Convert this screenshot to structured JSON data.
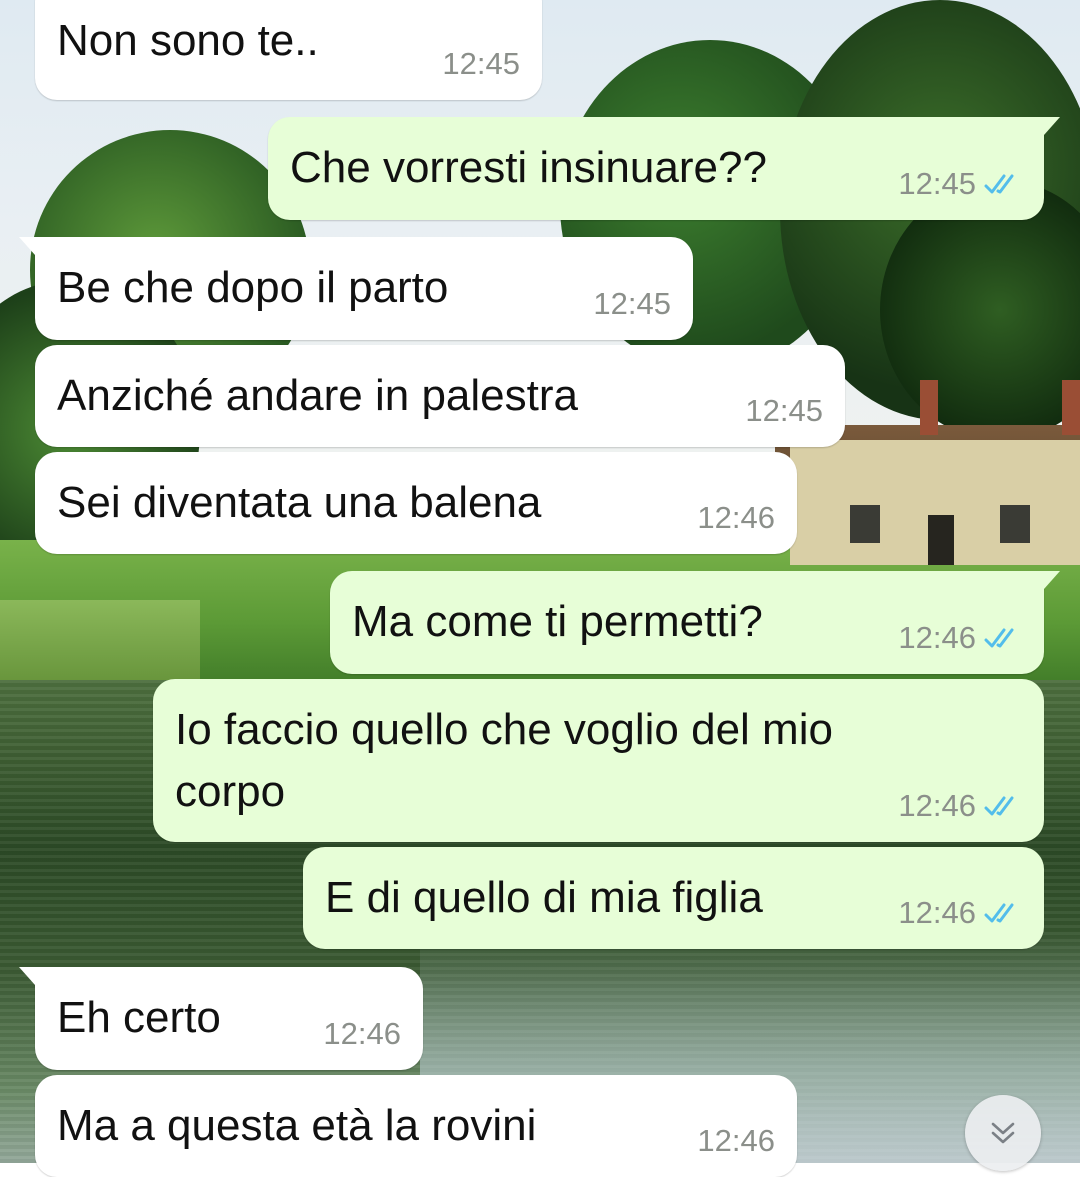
{
  "chat": {
    "messages": [
      {
        "direction": "incoming",
        "text": "Non sono te..",
        "time": "12:45"
      },
      {
        "direction": "outgoing",
        "text": "Che vorresti insinuare??",
        "time": "12:45",
        "status": "read"
      },
      {
        "direction": "incoming",
        "text": "Be che dopo il parto",
        "time": "12:45"
      },
      {
        "direction": "incoming",
        "text": "Anziché andare in palestra",
        "time": "12:45"
      },
      {
        "direction": "incoming",
        "text": "Sei diventata una balena",
        "time": "12:46"
      },
      {
        "direction": "outgoing",
        "text": "Ma come ti permetti?",
        "time": "12:46",
        "status": "read"
      },
      {
        "direction": "outgoing",
        "text": "Io faccio quello che voglio del mio\ncorpo",
        "time": "12:46",
        "status": "read"
      },
      {
        "direction": "outgoing",
        "text": "E di quello di mia figlia",
        "time": "12:46",
        "status": "read"
      },
      {
        "direction": "incoming",
        "text": "Eh certo",
        "time": "12:46"
      },
      {
        "direction": "incoming",
        "text": "Ma a questa età la rovini",
        "time": "12:46"
      }
    ]
  },
  "colors": {
    "incoming_bubble": "#ffffff",
    "outgoing_bubble": "#e7fed7",
    "read_ticks": "#53bdeb",
    "timestamp": "#8b8f8a"
  },
  "icons": {
    "read_receipt": "double-check-icon",
    "scroll_down": "double-chevron-down-icon"
  }
}
